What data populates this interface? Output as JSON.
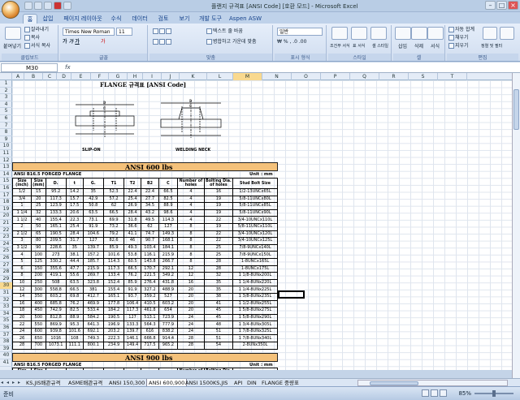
{
  "window": {
    "title": "플랜지 규격표 [ANSI Code] [호환 모드] - Microsoft Excel"
  },
  "tabs": [
    "홈",
    "삽입",
    "페이지 레이아웃",
    "수식",
    "데이터",
    "검토",
    "보기",
    "개발 도구",
    "Aspen ASW"
  ],
  "ribbon": {
    "clipboard": {
      "label": "클립보드",
      "paste": "붙여넣기",
      "cut": "잘라내기",
      "copy": "복사",
      "format_painter": "서식 복사"
    },
    "font": {
      "label": "글꼴",
      "name": "Times New Roman",
      "size": "11"
    },
    "alignment": {
      "label": "맞춤",
      "wrap": "텍스트 줄 바꿈",
      "merge": "병합하고 가운데 맞춤"
    },
    "number": {
      "label": "표시 형식",
      "format": "일반"
    },
    "styles": {
      "label": "스타일",
      "conditional": "조건부 서식",
      "table": "표 서식",
      "cell": "셀 스타일"
    },
    "cells": {
      "label": "셀",
      "insert": "삽입",
      "delete": "삭제",
      "format": "서식"
    },
    "editing": {
      "label": "편집",
      "autosum": "자동 합계",
      "fill": "채우기",
      "clear": "지우기",
      "sort": "정렬 및 필터",
      "find": "찾기 및 선택"
    }
  },
  "formula_bar": {
    "name_box": "M30",
    "fx": "fx",
    "value": ""
  },
  "columns": [
    "A",
    "B",
    "C",
    "D",
    "E",
    "F",
    "G",
    "H",
    "I",
    "J",
    "K",
    "L",
    "M",
    "N",
    "O",
    "P",
    "Q",
    "R",
    "S",
    "T"
  ],
  "selected_column": "M",
  "selected_row": "30",
  "rows": [
    "1",
    "2",
    "3",
    "4",
    "5",
    "6",
    "7",
    "8",
    "9",
    "10",
    "11",
    "12",
    "13",
    "14",
    "15",
    "16",
    "17",
    "18",
    "19",
    "20",
    "21",
    "22",
    "23",
    "24",
    "25",
    "26",
    "27",
    "28",
    "29",
    "30",
    "31",
    "32",
    "33",
    "34",
    "35",
    "36",
    "37",
    "38",
    "39",
    "40",
    "41"
  ],
  "sheet": {
    "title": "FLANGE 규격표 [ANSI Code]",
    "label_slip_on": "SLIP-ON",
    "label_welding_neck": "WELDING NECK",
    "band1": "ANSI 600 lbs",
    "caption1": "ANSI B16.5 FORGED FLANGE",
    "unit1": "Unit : mm",
    "band2": "ANSI 900 lbs",
    "caption2": "ANSI B16.5 FORGED FLANGE",
    "unit2": "Unit : mm",
    "headers": [
      "Size (inch)",
      "Size (mm)",
      "D.",
      "t",
      "G.",
      "T1",
      "T2",
      "B2",
      "C",
      "Number of holes",
      "Bolting Dia. of holes",
      "Stud Bolt Size"
    ],
    "rows600": [
      [
        "1/2",
        "15",
        "95.2",
        "14.2",
        "35",
        "52.3",
        "22.4",
        "22.4",
        "66.5",
        "4",
        "16",
        "1/2-13UNCx65L"
      ],
      [
        "3/4",
        "20",
        "117.3",
        "15.7",
        "42.9",
        "57.2",
        "25.4",
        "27.7",
        "82.5",
        "4",
        "19",
        "5/8-11UNCx80L"
      ],
      [
        "1",
        "25",
        "123.9",
        "17.5",
        "50.8",
        "62",
        "26.9",
        "34.5",
        "88.9",
        "4",
        "19",
        "5/8-11UNCx85L"
      ],
      [
        "1 1/4",
        "32",
        "133.3",
        "20.6",
        "63.5",
        "66.5",
        "28.4",
        "43.2",
        "98.6",
        "4",
        "19",
        "5/8-11UNCx90L"
      ],
      [
        "1 1/2",
        "40",
        "155.4",
        "22.3",
        "73.1",
        "69.9",
        "31.8",
        "49.5",
        "114.3",
        "4",
        "22",
        "3/4-10UNCx110L"
      ],
      [
        "2",
        "50",
        "165.1",
        "25.4",
        "91.9",
        "73.2",
        "36.6",
        "62",
        "127",
        "8",
        "19",
        "5/8-11UNCx110L"
      ],
      [
        "2 1/2",
        "65",
        "190.5",
        "28.4",
        "104.6",
        "79.2",
        "41.1",
        "74.7",
        "149.3",
        "8",
        "22",
        "3/4-10UNCx120L"
      ],
      [
        "3",
        "80",
        "209.5",
        "31.7",
        "127",
        "82.6",
        "46",
        "90.7",
        "168.1",
        "8",
        "22",
        "3/4-10UNCx125L"
      ],
      [
        "3 1/2",
        "90",
        "228.6",
        "35",
        "139.7",
        "85.9",
        "49.3",
        "103.4",
        "184.1",
        "8",
        "25",
        "7/8-9UNCx140L"
      ],
      [
        "4",
        "100",
        "273",
        "38.1",
        "157.2",
        "101.6",
        "53.8",
        "116.1",
        "215.9",
        "8",
        "25",
        "7/8-9UNCx150L"
      ],
      [
        "5",
        "125",
        "330.2",
        "44.4",
        "185.7",
        "114.3",
        "60.5",
        "143.8",
        "266.7",
        "8",
        "28",
        "1-8UNCx165L"
      ],
      [
        "6",
        "150",
        "355.6",
        "47.7",
        "215.9",
        "117.3",
        "66.5",
        "170.7",
        "292.1",
        "12",
        "28",
        "1-8UNCx175L"
      ],
      [
        "8",
        "200",
        "419.1",
        "55.6",
        "269.7",
        "133.4",
        "76.2",
        "221.5",
        "349.2",
        "12",
        "32",
        "1 1/8-8UNx200L"
      ],
      [
        "10",
        "250",
        "508",
        "63.5",
        "323.8",
        "152.4",
        "85.9",
        "276.4",
        "431.8",
        "16",
        "35",
        "1 1/4-8UNx220L"
      ],
      [
        "12",
        "300",
        "558.8",
        "66.5",
        "381",
        "155.4",
        "91.9",
        "327.2",
        "488.9",
        "20",
        "35",
        "1 1/4-8UNx225L"
      ],
      [
        "14",
        "350",
        "603.2",
        "69.8",
        "412.7",
        "165.1",
        "93.7",
        "359.2",
        "527",
        "20",
        "38",
        "1 3/8-8UNx235L"
      ],
      [
        "16",
        "400",
        "685.8",
        "76.2",
        "469.9",
        "177.8",
        "106.4",
        "410.5",
        "603.2",
        "20",
        "41",
        "1 1/2-8UNx255L"
      ],
      [
        "18",
        "450",
        "742.9",
        "82.5",
        "533.4",
        "184.2",
        "117.3",
        "461.8",
        "654",
        "20",
        "45",
        "1 5/8-8UNx275L"
      ],
      [
        "20",
        "500",
        "812.8",
        "88.9",
        "584.2",
        "190.5",
        "127",
        "513.1",
        "723.9",
        "24",
        "45",
        "1 5/8-8UNx290L"
      ],
      [
        "22",
        "550",
        "869.9",
        "95.3",
        "641.3",
        "196.9",
        "133.3",
        "564.3",
        "777.9",
        "24",
        "48",
        "1 3/4-8UNx305L"
      ],
      [
        "24",
        "600",
        "939.8",
        "101.6",
        "692.1",
        "203.2",
        "139.7",
        "616",
        "838.2",
        "24",
        "51",
        "1 7/8-8UNx325L"
      ],
      [
        "26",
        "650",
        "1016",
        "108",
        "749.3",
        "222.3",
        "146.1",
        "666.8",
        "914.4",
        "28",
        "51",
        "1 7/8-8UNx340L"
      ],
      [
        "28",
        "700",
        "1073.1",
        "111.1",
        "800.1",
        "234.9",
        "149.4",
        "717.5",
        "965.2",
        "28",
        "54",
        "2-8UNx350L"
      ]
    ]
  },
  "sheet_tabs": [
    "KS,JIS배관규격",
    "ASME배관규격",
    "ANSI 150,300",
    "ANSI 600,900",
    "ANSI 1500",
    "KS,JIS",
    "API",
    "DIN",
    "FLANGE 중량표"
  ],
  "active_sheet": "ANSI 600,900",
  "status": {
    "ready": "준비",
    "zoom": "85%"
  }
}
